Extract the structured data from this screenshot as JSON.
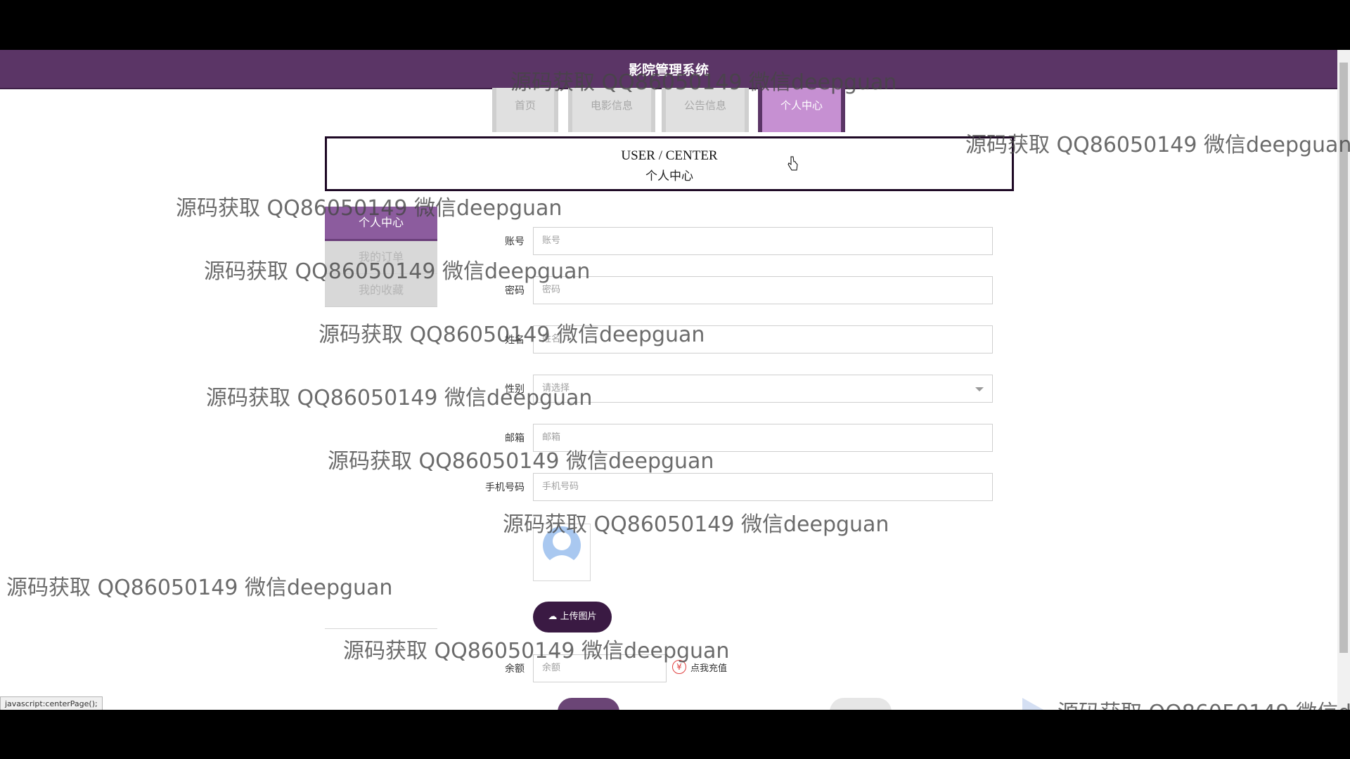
{
  "header": {
    "site_title": "影院管理系统"
  },
  "nav": {
    "tabs": [
      {
        "label": "首页"
      },
      {
        "label": "电影信息"
      },
      {
        "label": "公告信息"
      },
      {
        "label": "个人中心"
      }
    ],
    "active_index": 3
  },
  "banner": {
    "title_en": "USER / CENTER",
    "title_cn": "个人中心"
  },
  "sidebar": {
    "items": [
      {
        "label": "个人中心"
      },
      {
        "label": "我的订单"
      },
      {
        "label": "我的收藏"
      }
    ]
  },
  "form": {
    "account": {
      "label": "账号",
      "placeholder": "账号"
    },
    "password": {
      "label": "密码",
      "placeholder": "密码"
    },
    "name": {
      "label": "姓名",
      "placeholder": "姓名"
    },
    "gender": {
      "label": "性别",
      "placeholder": "请选择"
    },
    "email": {
      "label": "邮箱",
      "placeholder": "邮箱"
    },
    "phone": {
      "label": "手机号码",
      "placeholder": "手机号码"
    },
    "upload_label": "上传图片",
    "balance": {
      "label": "余额",
      "placeholder": "余额"
    },
    "recharge_label": "点我充值"
  },
  "status_bar": {
    "url": "javascript:centerPage();"
  },
  "watermark_text": "源码获取 QQ86050149 微信deepguan",
  "colors": {
    "header_bg": "#5b3566",
    "active_tab": "#c690d2",
    "sidebar_active": "#8c5c9e",
    "upload_button": "#3a1a43"
  }
}
